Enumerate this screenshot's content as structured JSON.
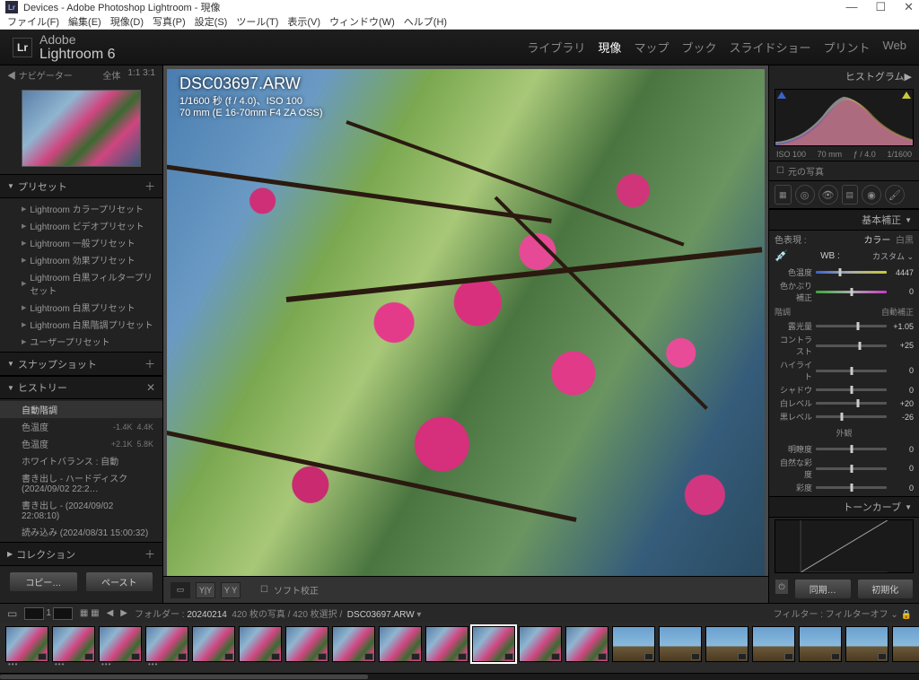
{
  "titlebar": {
    "title": "Devices - Adobe Photoshop Lightroom - 現像",
    "icon_text": "Lr"
  },
  "window_controls": {
    "min": "—",
    "max": "☐",
    "close": "✕"
  },
  "menubar": [
    "ファイル(F)",
    "編集(E)",
    "現像(D)",
    "写真(P)",
    "設定(S)",
    "ツール(T)",
    "表示(V)",
    "ウィンドウ(W)",
    "ヘルプ(H)"
  ],
  "appname": "Lightroom 6",
  "modules": {
    "items": [
      "ライブラリ",
      "現像",
      "マップ",
      "ブック",
      "スライドショー",
      "プリント",
      "Web"
    ],
    "active": 1
  },
  "navigator": {
    "title": "ナビゲーター",
    "fit": "全体",
    "ratios": "1:1   3:1"
  },
  "presets_title": "プリセット",
  "presets": [
    "Lightroom カラープリセット",
    "Lightroom ビデオプリセット",
    "Lightroom 一般プリセット",
    "Lightroom 効果プリセット",
    "Lightroom 白黒フィルタープリセット",
    "Lightroom 白黒プリセット",
    "Lightroom 白黒階調プリセット",
    "ユーザープリセット"
  ],
  "snapshot_title": "スナップショット",
  "history_title": "ヒストリー",
  "history": [
    {
      "label": "自動階調",
      "v1": "",
      "v2": ""
    },
    {
      "label": "色温度",
      "v1": "-1.4K",
      "v2": "4.4K"
    },
    {
      "label": "色温度",
      "v1": "+2.1K",
      "v2": "5.8K"
    },
    {
      "label": "ホワイトバランス : 自動",
      "v1": "",
      "v2": ""
    },
    {
      "label": "書き出し - ハードディスク (2024/09/02 22:2…",
      "v1": "",
      "v2": ""
    },
    {
      "label": "書き出し - (2024/09/02 22:08:10)",
      "v1": "",
      "v2": ""
    },
    {
      "label": "読み込み (2024/08/31 15:00:32)",
      "v1": "",
      "v2": ""
    }
  ],
  "collection_title": "コレクション",
  "copy_btn": "コピー…",
  "paste_btn": "ペースト",
  "image": {
    "filename": "DSC03697.ARW",
    "exposure": "1/1600 秒 (f / 4.0)、ISO 100",
    "lens": "70 mm (E 16-70mm F4 ZA OSS)"
  },
  "soft_proof": "ソフト校正",
  "right": {
    "histogram_title": "ヒストグラム",
    "exif": {
      "iso": "ISO 100",
      "focal": "70 mm",
      "ap": "ƒ / 4.0",
      "sh": "1/1600"
    },
    "original": "元の写真",
    "basic_title": "基本補正",
    "treatment": {
      "label": "色表現 :",
      "color": "カラー",
      "bw": "白黒"
    },
    "wb": {
      "lbl": "WB :",
      "mode": "カスタム"
    },
    "temp": {
      "label": "色温度",
      "value": "4447"
    },
    "tint": {
      "label": "色かぶり補正",
      "value": "0"
    },
    "tone_title": "階調",
    "auto_label": "自動補正",
    "exp": {
      "label": "露光量",
      "value": "+1.05"
    },
    "contrast": {
      "label": "コントラスト",
      "value": "+25"
    },
    "hi": {
      "label": "ハイライト",
      "value": "0"
    },
    "sh": {
      "label": "シャドウ",
      "value": "0"
    },
    "white": {
      "label": "白レベル",
      "value": "+20"
    },
    "black": {
      "label": "黒レベル",
      "value": "-26"
    },
    "presence_title": "外観",
    "clarity": {
      "label": "明瞭度",
      "value": "0"
    },
    "vibrance": {
      "label": "自然な彩度",
      "value": "0"
    },
    "sat": {
      "label": "彩度",
      "value": "0"
    },
    "tonecurve_title": "トーンカーブ",
    "sync": "同期…",
    "reset": "初期化"
  },
  "filmstrip": {
    "folder_label": "フォルダー :",
    "folder": "20240214",
    "count": "420 枚の写真 / 420 枚選択 /",
    "file": "DSC03697.ARW",
    "filter_label": "フィルター :",
    "filter_mode": "フィルターオフ"
  }
}
